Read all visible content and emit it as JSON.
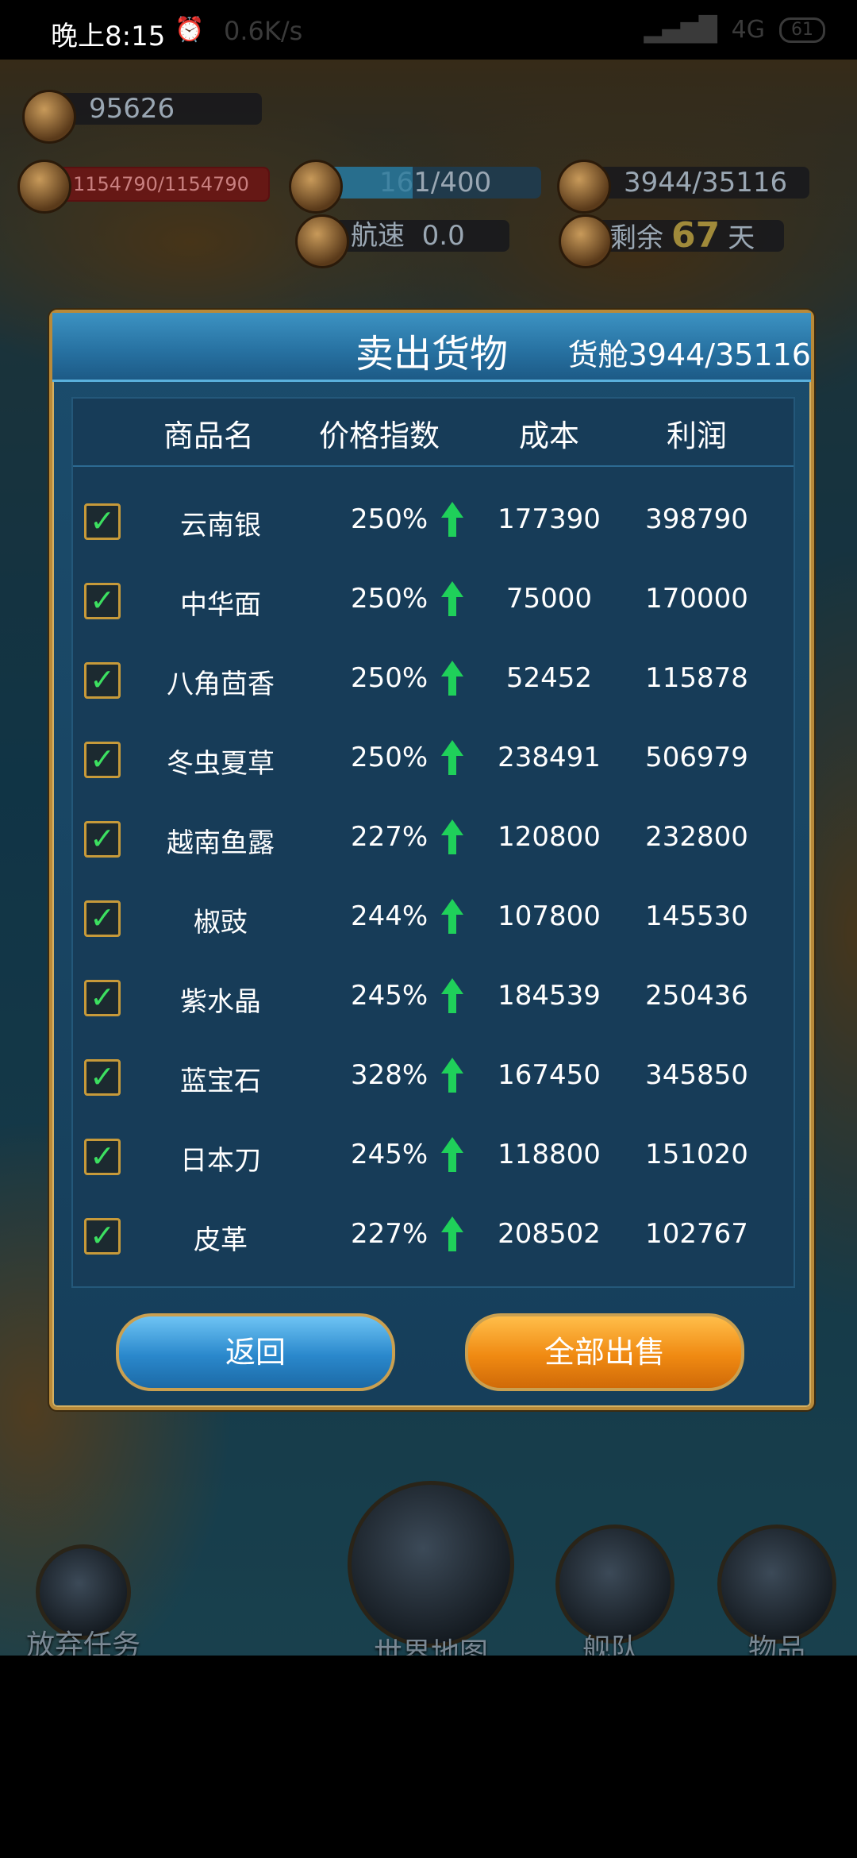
{
  "status_bar": {
    "time": "晚上8:15",
    "net_speed": "0.6K/s",
    "network": "4G",
    "battery": "61"
  },
  "hud": {
    "gold": "95626",
    "durability": "1154790/1154790",
    "crew": "161/400",
    "crew_fill": 0.4,
    "cargo": "3944/35116",
    "speed_label": "航速",
    "speed_value": "0.0",
    "days_label": "剩余",
    "days_value": "67",
    "days_unit": "天"
  },
  "dialog": {
    "title": "卖出货物",
    "cargo_hold": "货舱3944/35116",
    "headers": [
      "商品名",
      "价格指数",
      "成本",
      "利润"
    ],
    "rows": [
      {
        "name": "云南银",
        "price_index": "250%",
        "cost": "177390",
        "profit": "398790"
      },
      {
        "name": "中华面",
        "price_index": "250%",
        "cost": "75000",
        "profit": "170000"
      },
      {
        "name": "八角茴香",
        "price_index": "250%",
        "cost": "52452",
        "profit": "115878"
      },
      {
        "name": "冬虫夏草",
        "price_index": "250%",
        "cost": "238491",
        "profit": "506979"
      },
      {
        "name": "越南鱼露",
        "price_index": "227%",
        "cost": "120800",
        "profit": "232800"
      },
      {
        "name": "椒豉",
        "price_index": "244%",
        "cost": "107800",
        "profit": "145530"
      },
      {
        "name": "紫水晶",
        "price_index": "245%",
        "cost": "184539",
        "profit": "250436"
      },
      {
        "name": "蓝宝石",
        "price_index": "328%",
        "cost": "167450",
        "profit": "345850"
      },
      {
        "name": "日本刀",
        "price_index": "245%",
        "cost": "118800",
        "profit": "151020"
      },
      {
        "name": "皮革",
        "price_index": "227%",
        "cost": "208502",
        "profit": "102767"
      }
    ],
    "back_label": "返回",
    "sell_all_label": "全部出售"
  },
  "bottom_nav": {
    "abandon": "放弃任务",
    "world_map": "世界地图",
    "fleet": "舰队",
    "items": "物品"
  },
  "colors": {
    "accent_blue": "#2a88cc",
    "accent_orange": "#f08a12",
    "check_green": "#3ce060"
  }
}
